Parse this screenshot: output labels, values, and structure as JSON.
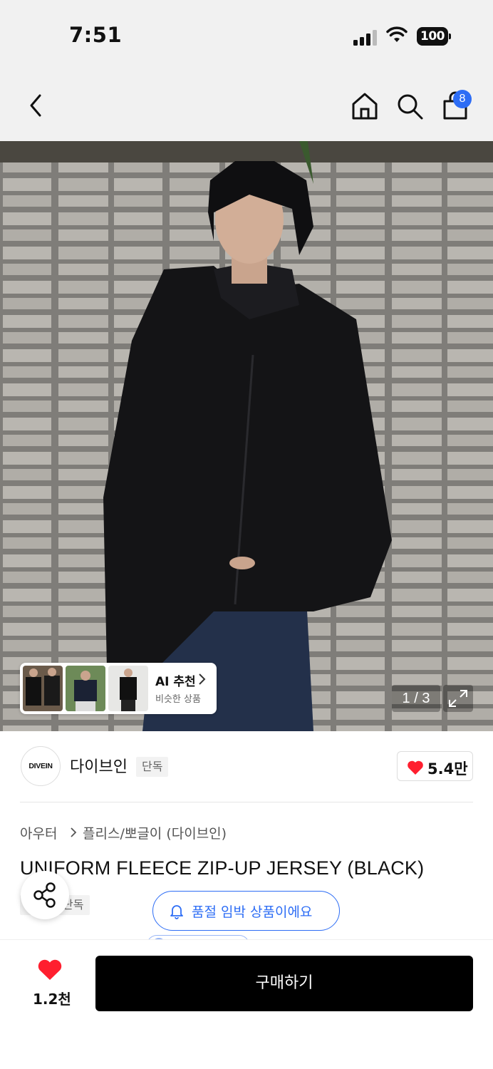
{
  "status_bar": {
    "time": "7:51",
    "battery": "100"
  },
  "nav": {
    "back_icon": "chevron-left-icon",
    "home_icon": "home-icon",
    "search_icon": "search-icon",
    "cart_icon": "shopping-bag-icon",
    "cart_count": "8"
  },
  "gallery": {
    "counter": "1 / 3",
    "expand_icon": "expand-icon",
    "ai_recommend": {
      "title": "AI 추천",
      "subtitle": "비슷한 상품"
    }
  },
  "brand": {
    "logo_text": "DIVEIN",
    "name": "다이브인",
    "badge": "단독",
    "like_count": "5.4만"
  },
  "product": {
    "breadcrumb_top": "아우터",
    "breadcrumb_category": "플리스/뽀글이 (다이브인)",
    "title": "UNIFORM FLEECE ZIP-UP JERSEY (BLACK)",
    "tag": "단독"
  },
  "notice": {
    "soldout_text": "품절 임박 상품이에요"
  },
  "bottom": {
    "wish_count": "1.2천",
    "buy_label": "구매하기"
  },
  "colors": {
    "accent_blue": "#2d6df5",
    "heart_red": "#ff1f2f",
    "buy_button": "#000000"
  }
}
